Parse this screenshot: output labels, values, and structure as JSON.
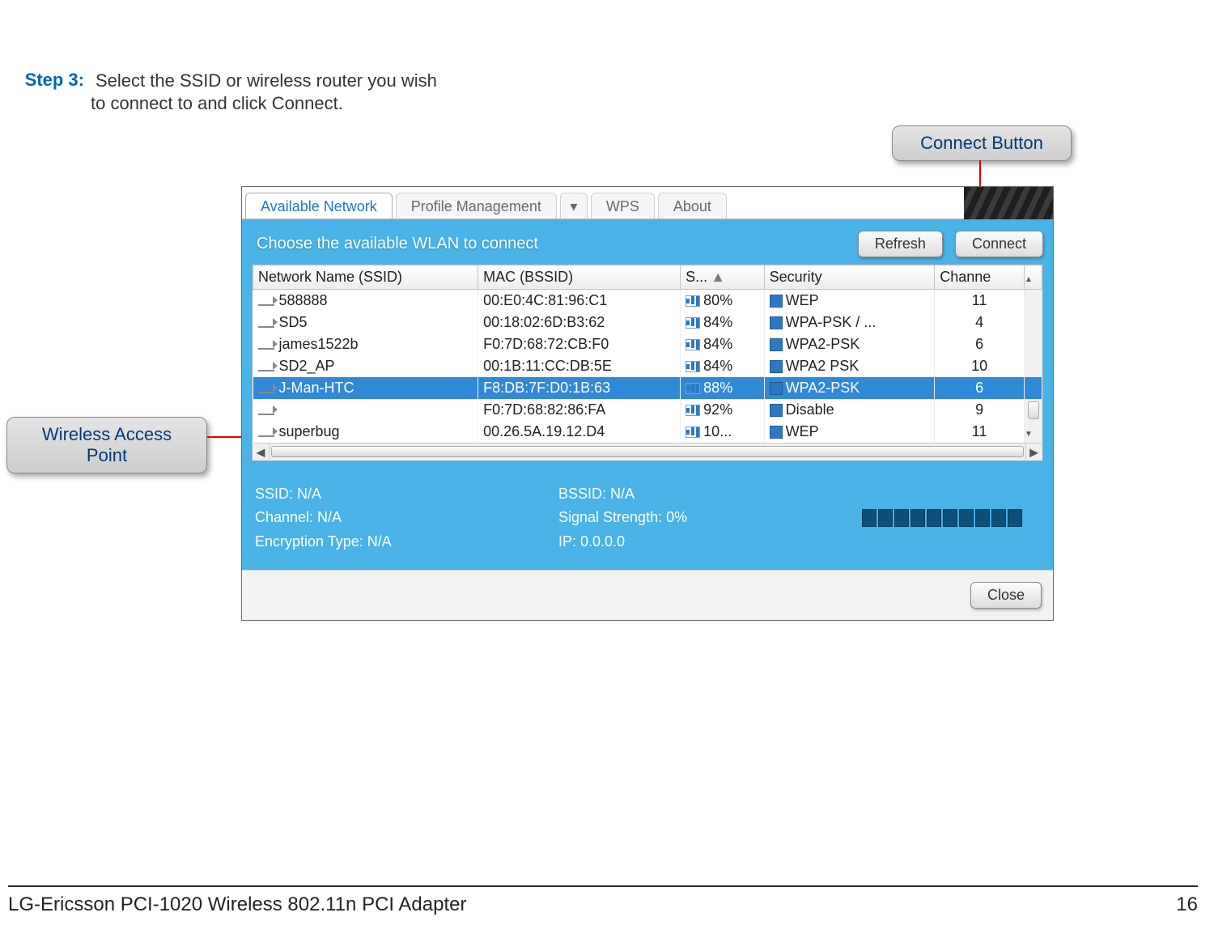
{
  "step": {
    "label": "Step 3:",
    "text": "Select the SSID or wireless router you wish to connect to and click Connect."
  },
  "callouts": {
    "connect": "Connect Button",
    "wap": "Wireless Access Point"
  },
  "tabs": {
    "available": "Available Network",
    "profile": "Profile Management",
    "dropdown_glyph": "▾",
    "wps": "WPS",
    "about": "About"
  },
  "panel": {
    "title": "Choose the available WLAN to connect",
    "refresh": "Refresh",
    "connect": "Connect"
  },
  "columns": {
    "ssid": "Network Name (SSID)",
    "bssid": "MAC (BSSID)",
    "signal_short": "S...",
    "security": "Security",
    "channel": "Channe"
  },
  "rows": [
    {
      "ssid": "588888",
      "bssid": "00:E0:4C:81:96:C1",
      "signal": "80%",
      "security": "WEP",
      "channel": "11",
      "selected": false
    },
    {
      "ssid": "SD5",
      "bssid": "00:18:02:6D:B3:62",
      "signal": "84%",
      "security": "WPA-PSK / ...",
      "channel": "4",
      "selected": false
    },
    {
      "ssid": "james1522b",
      "bssid": "F0:7D:68:72:CB:F0",
      "signal": "84%",
      "security": "WPA2-PSK",
      "channel": "6",
      "selected": false
    },
    {
      "ssid": "SD2_AP",
      "bssid": "00:1B:11:CC:DB:5E",
      "signal": "84%",
      "security": "WPA2 PSK",
      "channel": "10",
      "selected": false
    },
    {
      "ssid": "J-Man-HTC",
      "bssid": "F8:DB:7F:D0:1B:63",
      "signal": "88%",
      "security": "WPA2-PSK",
      "channel": "6",
      "selected": true
    },
    {
      "ssid": "",
      "bssid": "F0:7D:68:82:86:FA",
      "signal": "92%",
      "security": "Disable",
      "channel": "9",
      "selected": false
    },
    {
      "ssid": "superbug",
      "bssid": "00.26.5A.19.12.D4",
      "signal": "10...",
      "security": "WEP",
      "channel": "11",
      "selected": false
    }
  ],
  "status": {
    "ssid": "SSID: N/A",
    "bssid": "BSSID: N/A",
    "channel": "Channel: N/A",
    "signal": "Signal Strength: 0%",
    "enc": "Encryption Type: N/A",
    "ip": "IP: 0.0.0.0"
  },
  "close": "Close",
  "footer": {
    "product": "LG-Ericsson PCI-1020 Wireless 802.11n PCI Adapter",
    "page": "16"
  },
  "glyphs": {
    "sort": "▲",
    "up": "▲",
    "down": "▼",
    "left": "◄",
    "right": "►"
  }
}
